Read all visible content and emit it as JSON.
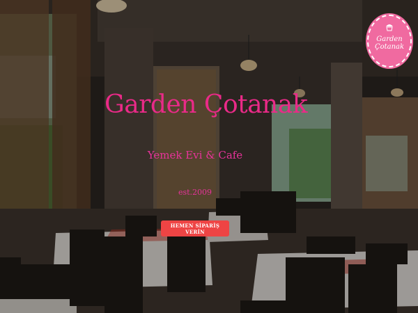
{
  "brand": {
    "logo_text_line1": "Garden",
    "logo_text_line2": "Çotanak"
  },
  "hero": {
    "title": "Garden Çotanak",
    "subtitle": "Yemek Evi & Cafe",
    "established": "est.2009",
    "cta_label": "HEMEN SİPARİŞ VERİN"
  },
  "colors": {
    "accent_pink": "#ea2a88",
    "logo_pink": "#f06aa0",
    "cta_red": "#ee4444"
  }
}
